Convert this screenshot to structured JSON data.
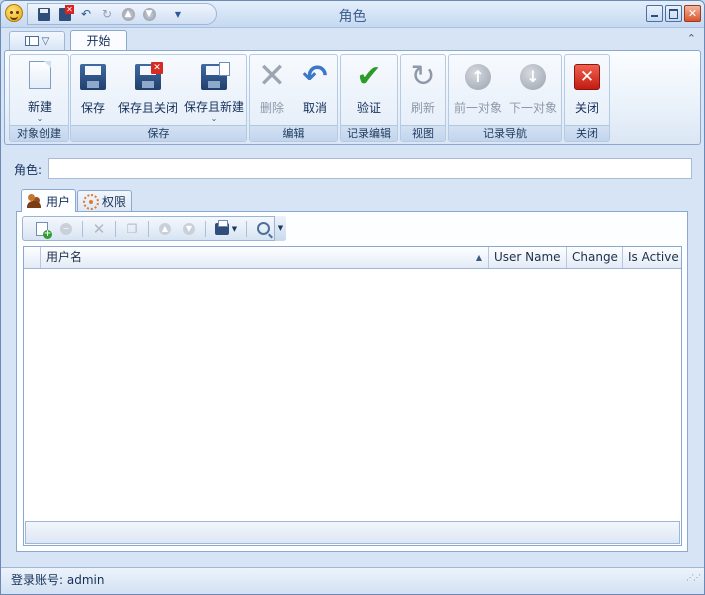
{
  "window": {
    "title": "角色"
  },
  "ribbon": {
    "tabs": [
      {
        "label": "开始"
      }
    ],
    "groups": {
      "create": {
        "label": "对象创建",
        "new": "新建"
      },
      "save": {
        "label": "保存",
        "save": "保存",
        "save_close": "保存且关闭",
        "save_new": "保存且新建"
      },
      "edit": {
        "label": "编辑",
        "delete": "删除",
        "cancel": "取消"
      },
      "record_edit": {
        "label": "记录编辑",
        "validate": "验证"
      },
      "view": {
        "label": "视图",
        "refresh": "刷新"
      },
      "nav": {
        "label": "记录导航",
        "prev": "前一对象",
        "next": "下一对象"
      },
      "close": {
        "label": "关闭",
        "close": "关闭"
      }
    }
  },
  "form": {
    "role_label": "角色:",
    "role_value": ""
  },
  "detail_tabs": [
    {
      "label": "用户"
    },
    {
      "label": "权限"
    }
  ],
  "grid": {
    "columns": [
      {
        "label": "用户名",
        "sorted": "ascending"
      },
      {
        "label": "User Name"
      },
      {
        "label": "Change"
      },
      {
        "label": "Is Active"
      }
    ],
    "rows": []
  },
  "status": {
    "login_label": "登录账号: admin"
  },
  "colors": {
    "accent": "#1e395b",
    "ribbon_border": "#8ba9cf",
    "close_red": "#c21c11",
    "validate_green": "#2c9b2c"
  },
  "icons": {
    "qat": [
      "save-icon",
      "save-close-icon",
      "undo-icon",
      "redo-icon",
      "previous-icon",
      "next-icon",
      "customize-icon"
    ],
    "grid_toolbar": [
      "new-record-icon",
      "delete-record-icon",
      "remove-icon",
      "copy-icon",
      "previous-icon",
      "next-icon",
      "print-icon",
      "search-icon"
    ]
  }
}
